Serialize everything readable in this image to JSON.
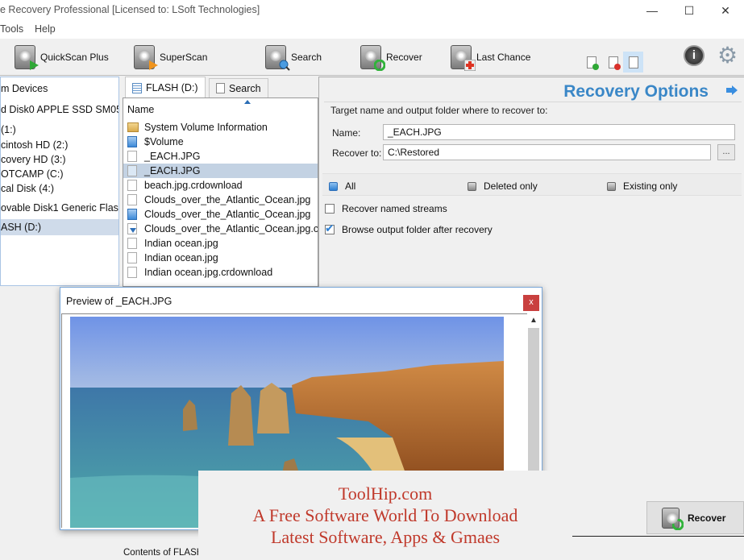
{
  "window": {
    "title": "e Recovery Professional [Licensed to: LSoft Technologies]",
    "controls": {
      "minimize": "—",
      "maximize": "☐",
      "close": "✕"
    }
  },
  "menu": {
    "items": [
      {
        "label": "Tools"
      },
      {
        "label": "Help"
      }
    ]
  },
  "toolbar": {
    "buttons": [
      {
        "label": "QuickScan Plus",
        "icon": "hdd-green-play-icon"
      },
      {
        "label": "SuperScan",
        "icon": "hdd-orange-play-icon"
      },
      {
        "label": "Search",
        "icon": "hdd-magnifier-icon"
      },
      {
        "label": "Recover",
        "icon": "hdd-recycle-icon"
      },
      {
        "label": "Last Chance",
        "icon": "hdd-firstaid-icon"
      }
    ],
    "view_filters": [
      {
        "name": "show-existing",
        "icon": "doc-check-icon",
        "active": false
      },
      {
        "name": "show-deleted",
        "icon": "doc-x-icon",
        "active": false
      },
      {
        "name": "show-all",
        "icon": "doc-icon",
        "active": true
      }
    ],
    "about_icon": "info-icon",
    "settings_icon": "gear-icon"
  },
  "tree": {
    "items": [
      {
        "label": "m Devices",
        "selected": false
      },
      {
        "label": "d Disk0 APPLE SSD SM05...",
        "selected": false
      },
      {
        "label": " (1:)",
        "selected": false
      },
      {
        "label": "cintosh HD (2:)",
        "selected": false
      },
      {
        "label": "covery HD (3:)",
        "selected": false
      },
      {
        "label": "OTCAMP (C:)",
        "selected": false
      },
      {
        "label": "cal Disk (4:)",
        "selected": false
      },
      {
        "label": "ovable Disk1 Generic Flas...",
        "selected": false
      },
      {
        "label": "ASH (D:)",
        "selected": true
      }
    ]
  },
  "file_panel": {
    "tabs": [
      {
        "label": "FLASH (D:)",
        "active": true
      },
      {
        "label": "Search",
        "active": false
      }
    ],
    "column_header": "Name",
    "files": [
      {
        "name": "System Volume Information",
        "type": "folder",
        "selected": false
      },
      {
        "name": "$Volume",
        "type": "blue",
        "selected": false
      },
      {
        "name": "_EACH.JPG",
        "type": "file",
        "selected": false
      },
      {
        "name": "_EACH.JPG",
        "type": "blue",
        "selected": true
      },
      {
        "name": "beach.jpg.crdownload",
        "type": "file",
        "selected": false
      },
      {
        "name": "Clouds_over_the_Atlantic_Ocean.jpg",
        "type": "file",
        "selected": false
      },
      {
        "name": "Clouds_over_the_Atlantic_Ocean.jpg",
        "type": "blue",
        "selected": false
      },
      {
        "name": "Clouds_over_the_Atlantic_Ocean.jpg.crdownload",
        "type": "dl",
        "selected": false
      },
      {
        "name": "Indian ocean.jpg",
        "type": "file",
        "selected": false
      },
      {
        "name": "Indian ocean.jpg",
        "type": "file",
        "selected": false
      },
      {
        "name": "Indian ocean.jpg.crdownload",
        "type": "file",
        "selected": false
      }
    ]
  },
  "options": {
    "title": "Recovery Options",
    "group_label": "Target name and output folder where to recover to:",
    "name_label": "Name:",
    "name_value": "_EACH.JPG",
    "recover_to_label": "Recover to:",
    "recover_to_value": "C:\\Restored",
    "browse_label": "...",
    "filters": [
      {
        "label": "All",
        "checked": true
      },
      {
        "label": "Deleted only",
        "checked": false
      },
      {
        "label": "Existing only",
        "checked": false
      }
    ],
    "checkboxes": [
      {
        "label": "Recover named streams",
        "checked": false
      },
      {
        "label": "Browse output folder after recovery",
        "checked": true
      }
    ],
    "accent_color": "#3a87c7"
  },
  "preview": {
    "title": "Preview of _EACH.JPG",
    "close_label": "x",
    "image_desc": "coastal-cliffs-photo"
  },
  "footer": {
    "recover_label": "Recover",
    "status": "Contents of FLASH"
  },
  "watermark": {
    "line1": "ToolHip.com",
    "line2": "A Free Software World To Download",
    "line3": "Latest Software, Apps & Gmaes",
    "color": "#c0392b"
  }
}
